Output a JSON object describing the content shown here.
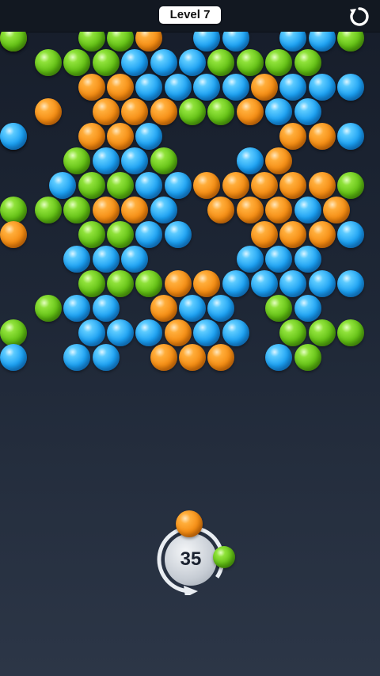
{
  "header": {
    "level_label": "Level 7"
  },
  "icons": {
    "restart": "restart-icon",
    "swap": "swap-arrow-icon"
  },
  "colors": {
    "blue": "#1a9ff2",
    "orange": "#f48a10",
    "green": "#5fbd12"
  },
  "board": {
    "rows": [
      "ggobbbbgog",
      "gggbbbgggg",
      "oobbbbobbb",
      "ooooggobb",
      "ooboobbb",
      "gbbgbo",
      "bggbbooooog",
      "ggoobooobog",
      "ggbbooobo",
      "bbbbbb",
      "gggoobbbbb",
      "gbbobbgb",
      "bbbobbgggg",
      "bbooobgb"
    ],
    "cols": [
      [
        1,
        2,
        3,
        5,
        6,
        8,
        9,
        10
      ],
      [
        0,
        1,
        2,
        3,
        4,
        5,
        6,
        7,
        8,
        9,
        10
      ],
      [
        1,
        2,
        3,
        4,
        5,
        6,
        7,
        8,
        9,
        10
      ],
      [
        0,
        2,
        3,
        4,
        5,
        6,
        7,
        8,
        9,
        10
      ],
      [
        1,
        2,
        3,
        8,
        9,
        10
      ],
      [
        1,
        2,
        3,
        4,
        7,
        8
      ],
      [
        0,
        1,
        2,
        3,
        4,
        5,
        6,
        7,
        8,
        9,
        10
      ],
      [
        0,
        1,
        2,
        3,
        4,
        6,
        7,
        8,
        9,
        10
      ],
      [
        1,
        2,
        3,
        4,
        7,
        8,
        9,
        10
      ],
      [
        1,
        2,
        3,
        7,
        8,
        9
      ],
      [
        1,
        2,
        3,
        4,
        5,
        6,
        7,
        8,
        9,
        10
      ],
      [
        0,
        1,
        2,
        4,
        5,
        6,
        8,
        9,
        10
      ],
      [
        1,
        2,
        3,
        4,
        5,
        6,
        8,
        9,
        10
      ],
      [
        1,
        2,
        4,
        5,
        6,
        8,
        9
      ]
    ]
  },
  "shooter": {
    "shots_left": "35",
    "current_ball": "orange",
    "next_ball": "green"
  }
}
